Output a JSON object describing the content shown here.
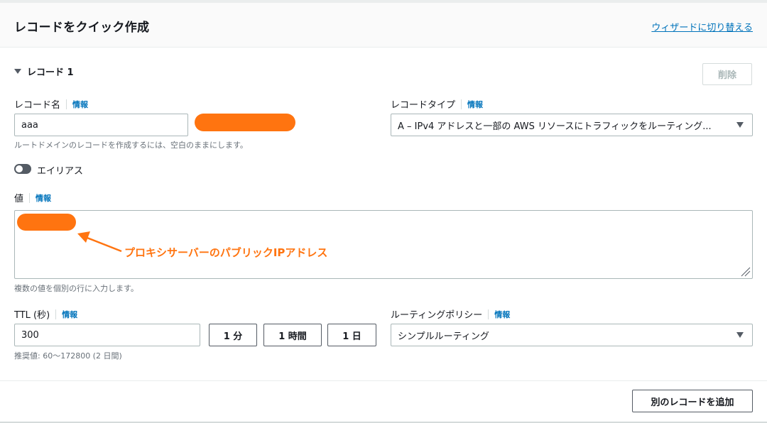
{
  "header": {
    "title": "レコードをクイック作成",
    "wizard_link": "ウィザードに切り替える"
  },
  "record": {
    "section_label": "レコード 1",
    "delete_label": "削除",
    "name": {
      "label": "レコード名",
      "info": "情報",
      "value": "aaa",
      "hint": "ルートドメインのレコードを作成するには、空白のままにします。"
    },
    "type": {
      "label": "レコードタイプ",
      "info": "情報",
      "selected": "A – IPv4 アドレスと一部の AWS リソースにトラフィックをルーティング..."
    },
    "alias": {
      "label": "エイリアス",
      "enabled": false
    },
    "value": {
      "label": "値",
      "info": "情報",
      "hint": "複数の値を個別の行に入力します。"
    },
    "ttl": {
      "label": "TTL (秒)",
      "info": "情報",
      "value": "300",
      "preset_1m": "1 分",
      "preset_1h": "1 時間",
      "preset_1d": "1 日",
      "hint": "推奨値: 60～172800 (2 日間)"
    },
    "routing": {
      "label": "ルーティングポリシー",
      "info": "情報",
      "selected": "シンプルルーティング"
    }
  },
  "annotation": {
    "text": "プロキシサーバーのパブリックIPアドレス",
    "color": "#ff7410"
  },
  "footer": {
    "add_label": "別のレコードを追加"
  },
  "colors": {
    "link": "#0073bb",
    "accent": "#ff7410"
  }
}
